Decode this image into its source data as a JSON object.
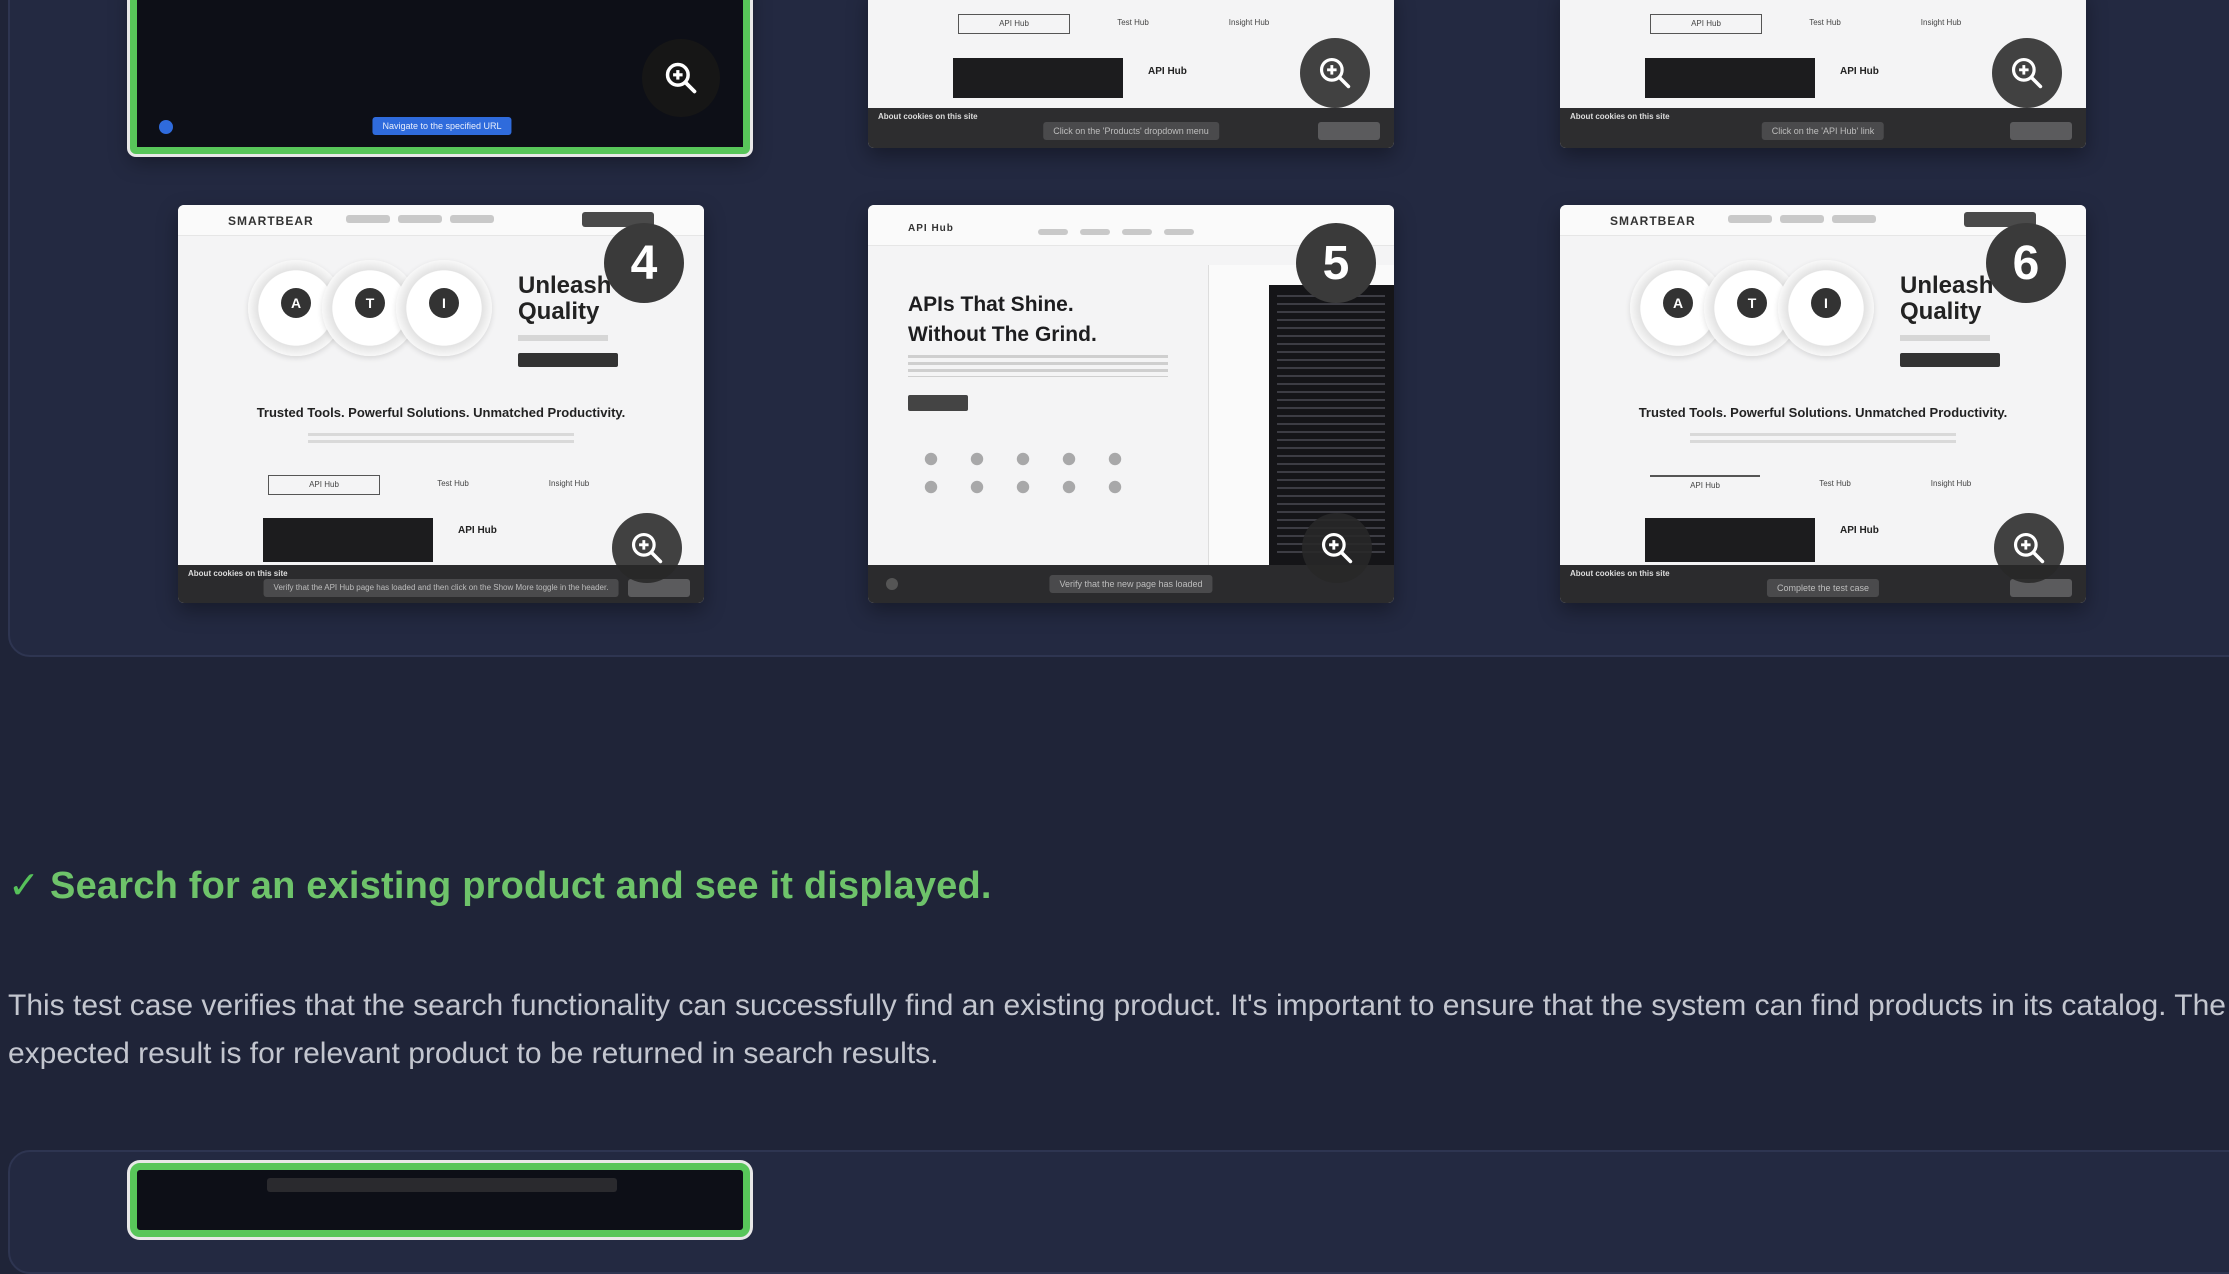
{
  "top_screenshots": [
    {
      "footer_text": "Navigate to the specified URL"
    },
    {
      "tabs": [
        "API Hub",
        "Test Hub",
        "Insight Hub"
      ],
      "apihub_label": "API Hub",
      "footer_text": "Click on the 'Products' dropdown menu",
      "cookie_title": "About cookies on this site"
    },
    {
      "tabs": [
        "API Hub",
        "Test Hub",
        "Insight Hub"
      ],
      "apihub_label": "API Hub",
      "footer_text": "Click on the 'API Hub' link",
      "cookie_title": "About cookies on this site"
    }
  ],
  "step_screenshots": [
    {
      "step": "4",
      "logo": "SMARTBEAR",
      "hero_title": "Unleash\nQuality",
      "rings": [
        "A",
        "T",
        "I"
      ],
      "tagline": "Trusted Tools. Powerful Solutions. Unmatched Productivity.",
      "tabs": [
        "API Hub",
        "Test Hub",
        "Insight Hub"
      ],
      "apihub_label": "API Hub",
      "cookie_title": "About cookies on this site",
      "footer_text": "Verify that the API Hub page has loaded and then click on the Show More toggle in the header."
    },
    {
      "step": "5",
      "logo": "API Hub",
      "hero_title": "APIs That Shine.\nWithout The Grind.",
      "footer_text": "Verify that the new page has loaded"
    },
    {
      "step": "6",
      "logo": "SMARTBEAR",
      "hero_title": "Unleash\nQuality",
      "rings": [
        "A",
        "T",
        "I"
      ],
      "tagline": "Trusted Tools. Powerful Solutions. Unmatched Productivity.",
      "tabs": [
        "API Hub",
        "Test Hub",
        "Insight Hub"
      ],
      "apihub_label": "API Hub",
      "cookie_title": "About cookies on this site",
      "footer_text": "Complete the test case"
    }
  ],
  "test_case": {
    "title": "Search for an existing product and see it displayed.",
    "status_icon": "check-icon",
    "description": "This test case verifies that the search functionality can successfully find an existing product. It's important to ensure that the system can find products in its catalog. The expected result is for relevant product to be returned in search results."
  },
  "colors": {
    "accent_green": "#6ec36a",
    "background": "#1f2438",
    "panel": "#232941"
  }
}
